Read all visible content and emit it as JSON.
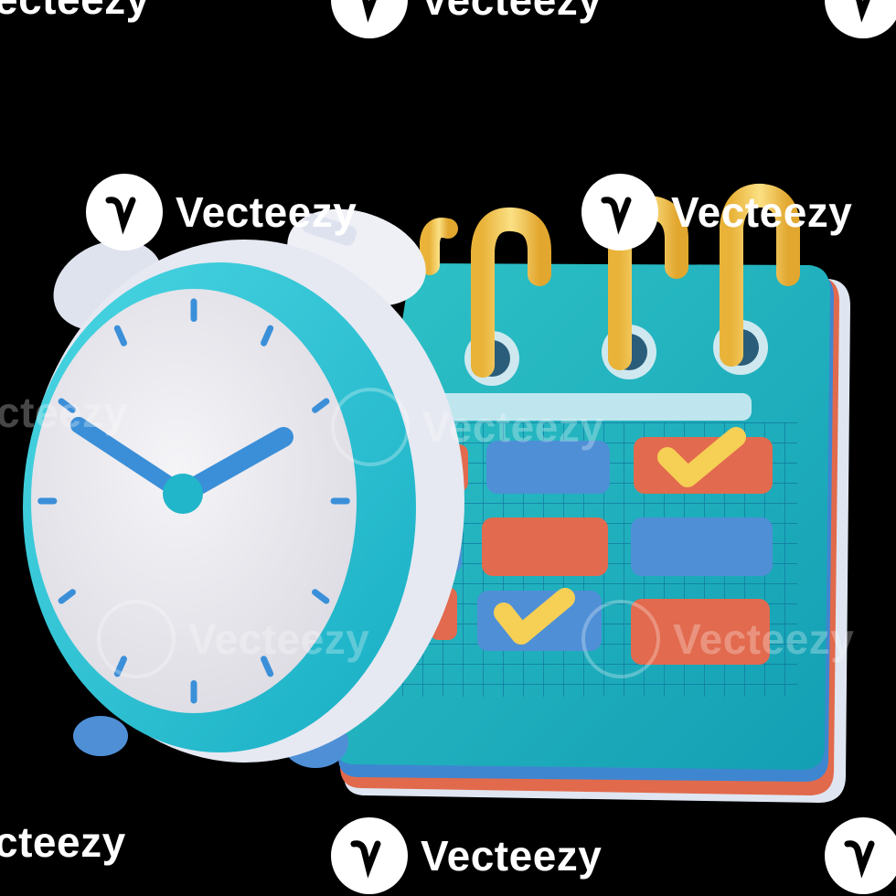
{
  "watermark": {
    "brand": "Vecteezy",
    "brand_clipped": "ecteezy",
    "brand_left_clipped": "cteezy",
    "icon": "vecteezy-logo-icon"
  },
  "illustration": {
    "clock_icon": "alarm-clock-icon",
    "calendar_icon": "calendar-icon",
    "checkmark_icon": "checkmark-icon",
    "clock_time": {
      "hour": 10,
      "minute": 10
    },
    "colors": {
      "clock_ring": "#2cc4d6",
      "clock_face": "#ecebef",
      "clock_hands": "#3a8fd8",
      "calendar_body": "#1bb3bd",
      "rings": "#f0c84e",
      "red_block": "#e26a4e",
      "blue_block": "#4f8fd6",
      "check": "#f6cf55"
    }
  }
}
